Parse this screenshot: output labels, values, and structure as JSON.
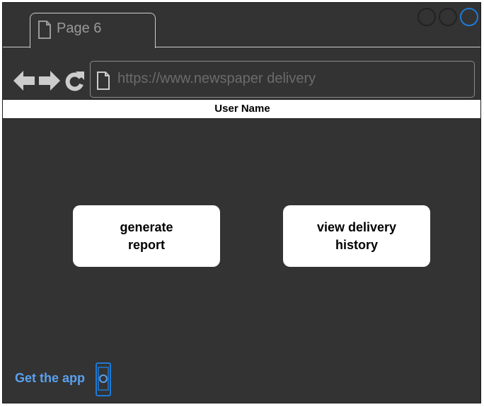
{
  "tab": {
    "title": "Page 6"
  },
  "address_bar": {
    "url": "https://www.newspaper delivery"
  },
  "header": {
    "user_name": "User Name"
  },
  "actions": [
    {
      "line1": "generate",
      "line2": "report"
    },
    {
      "line1": "view delivery",
      "line2": "history"
    }
  ],
  "footer": {
    "app_link": "Get the app"
  },
  "icons": {
    "tab": "document-icon",
    "back": "arrow-left-icon",
    "forward": "arrow-right-icon",
    "reload": "reload-icon",
    "page": "document-icon",
    "app": "mobile-phone-icon"
  },
  "colors": {
    "background": "#333333",
    "panel": "#ffffff",
    "muted_text": "#999999",
    "link": "#5aa0ee",
    "active_window_button": "#1e7ad6"
  }
}
